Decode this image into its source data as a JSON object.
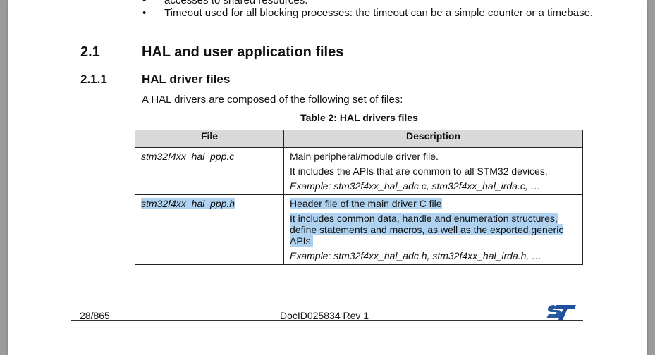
{
  "bullets": [
    "accesses to shared resources.",
    "Timeout used for all blocking processes: the timeout can be a simple counter or a timebase."
  ],
  "section": {
    "number": "2.1",
    "title": "HAL and user application files"
  },
  "subsection": {
    "number": "2.1.1",
    "title": "HAL driver files"
  },
  "intro": "A HAL drivers are composed of the following set of files:",
  "table": {
    "caption": "Table 2: HAL drivers files",
    "headers": [
      "File",
      "Description"
    ],
    "rows": [
      {
        "file": "stm32f4xx_hal_ppp.c",
        "desc": [
          "Main peripheral/module driver file.",
          "It includes the APIs that are common to all STM32 devices."
        ],
        "example": "Example: stm32f4xx_hal_adc.c, stm32f4xx_hal_irda.c, …"
      },
      {
        "file": "stm32f4xx_hal_ppp.h",
        "desc": [
          "Header file of the main driver C file",
          "It includes common data, handle and enumeration structures, define statements and macros, as well as the exported generic APIs."
        ],
        "example": "Example: stm32f4xx_hal_adc.h, stm32f4xx_hal_irda.h, …"
      }
    ]
  },
  "footer": {
    "page": "28/865",
    "docid": "DocID025834 Rev 1",
    "logo": "ST"
  },
  "colors": {
    "selection": "#aed2f0",
    "header_bg": "#d9d9d9",
    "logo": "#1e4f9c"
  }
}
